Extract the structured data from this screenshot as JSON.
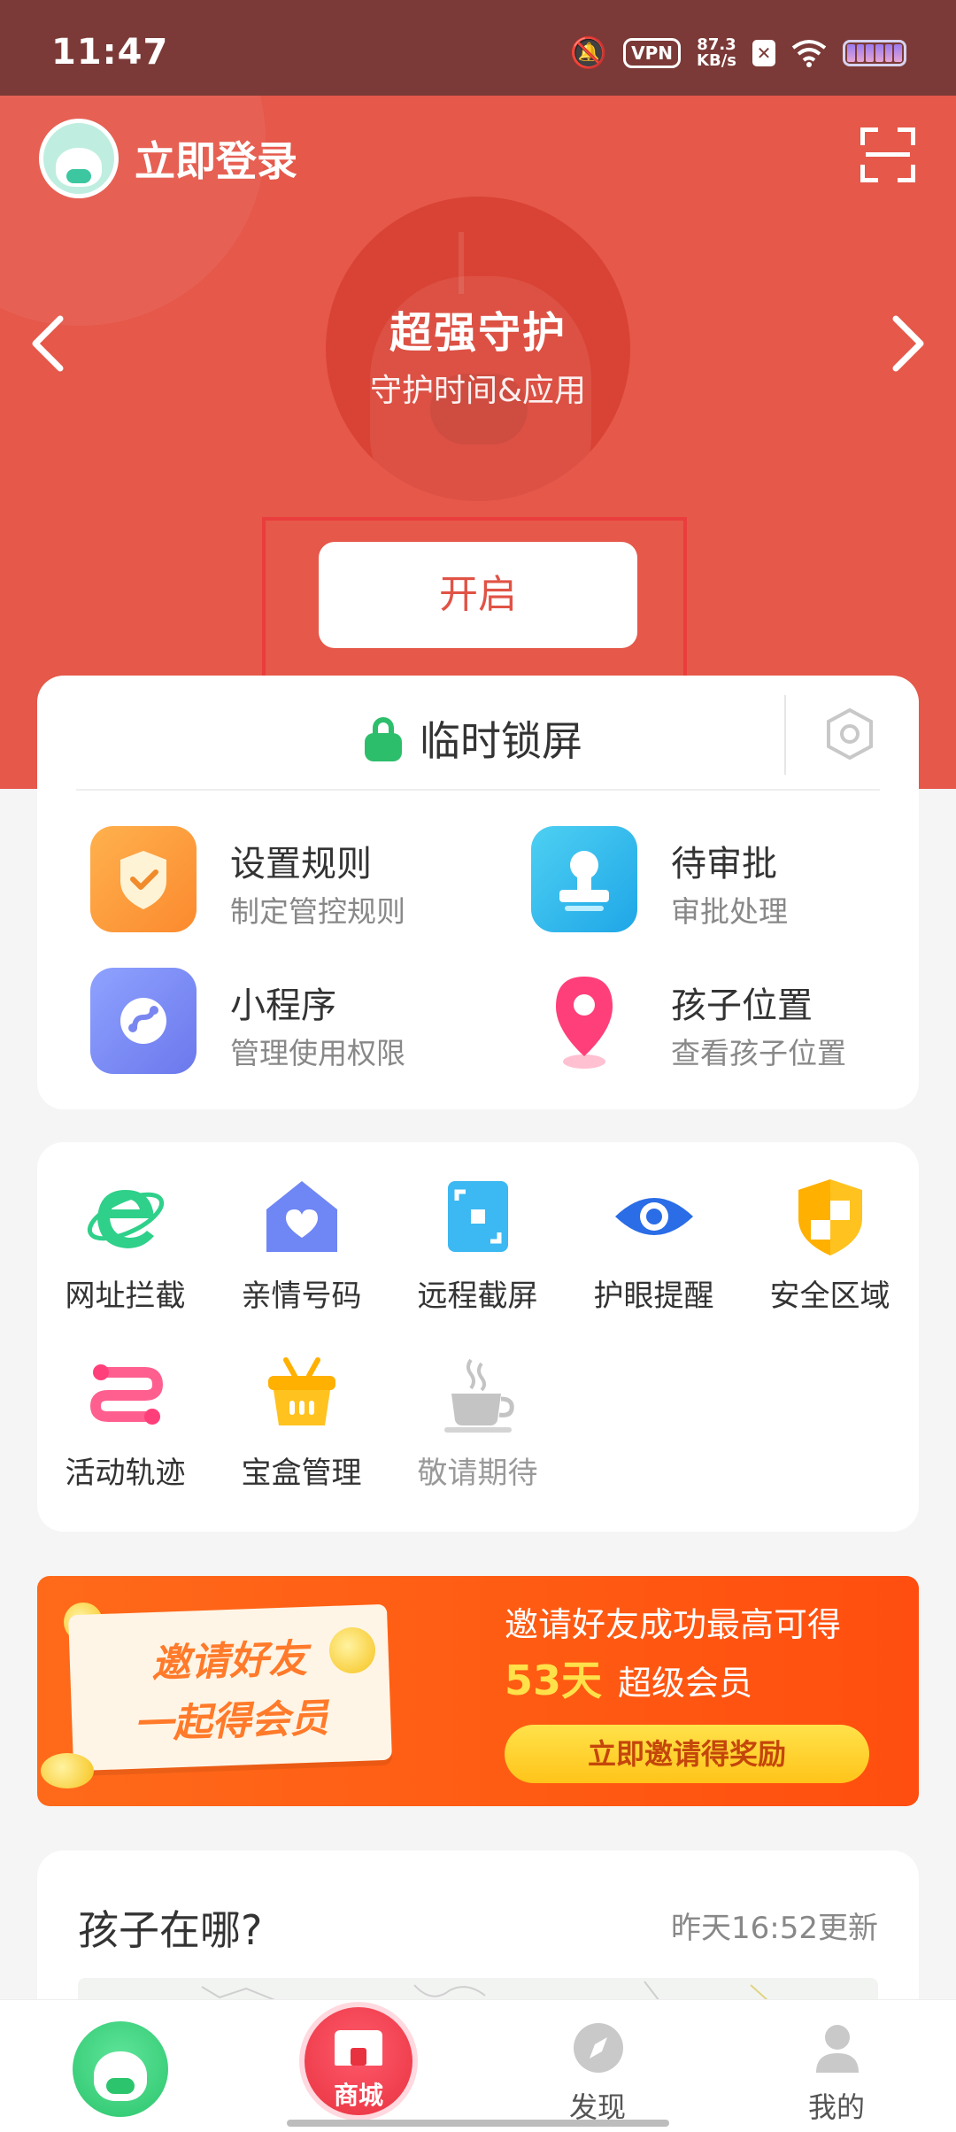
{
  "status_bar": {
    "time": "11:47",
    "vpn": "VPN",
    "speed_value": "87.3",
    "speed_unit": "KB/s"
  },
  "header": {
    "login_label": "立即登录",
    "mode_title": "超强守护",
    "mode_subtitle": "守护时间&应用",
    "open_button": "开启"
  },
  "lock_card": {
    "lock_label": "临时锁屏",
    "features": [
      {
        "title": "设置规则",
        "subtitle": "制定管控规则",
        "icon": "shield-check-icon"
      },
      {
        "title": "待审批",
        "subtitle": "审批处理",
        "icon": "stamp-icon"
      },
      {
        "title": "小程序",
        "subtitle": "管理使用权限",
        "icon": "mini-program-icon"
      },
      {
        "title": "孩子位置",
        "subtitle": "查看孩子位置",
        "icon": "location-pin-icon"
      }
    ]
  },
  "tools": [
    {
      "label": "网址拦截",
      "icon": "browser-e-icon"
    },
    {
      "label": "亲情号码",
      "icon": "home-heart-icon"
    },
    {
      "label": "远程截屏",
      "icon": "screenshot-icon"
    },
    {
      "label": "护眼提醒",
      "icon": "eye-icon"
    },
    {
      "label": "安全区域",
      "icon": "shield-icon"
    },
    {
      "label": "活动轨迹",
      "icon": "route-icon"
    },
    {
      "label": "宝盒管理",
      "icon": "basket-icon"
    },
    {
      "label": "敬请期待",
      "icon": "coffee-cup-icon"
    }
  ],
  "banner": {
    "sign_line1": "邀请好友",
    "sign_line2": "一起得会员",
    "line1": "邀请好友成功最高可得",
    "days": "53天",
    "member": "超级会员",
    "button": "立即邀请得奖励"
  },
  "location_card": {
    "title": "孩子在哪?",
    "updated": "昨天16:52更新"
  },
  "bottom_nav": {
    "shop": "商城",
    "discover": "发现",
    "mine": "我的"
  },
  "colors": {
    "header_red": "#e5584a",
    "status_bar": "#7b3a37",
    "lock_green": "#2dbe6c",
    "banner_orange": "#ff5a12"
  }
}
